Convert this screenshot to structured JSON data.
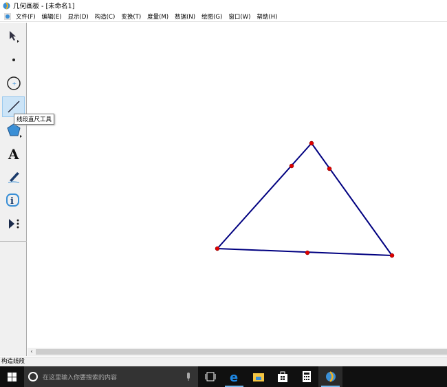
{
  "window": {
    "title": "几何画板 - [未命名1]"
  },
  "menu": [
    "文件(F)",
    "编辑(E)",
    "显示(D)",
    "构造(C)",
    "变换(T)",
    "度量(M)",
    "数据(N)",
    "绘图(G)",
    "窗口(W)",
    "帮助(H)"
  ],
  "toolbox": {
    "tooltip": "线段直尺工具",
    "tools": [
      "arrow",
      "point",
      "compass",
      "segment-straightedge",
      "polygon",
      "text",
      "marker",
      "information",
      "custom"
    ]
  },
  "status": "构造线段",
  "taskbar": {
    "search_placeholder": "在这里输入你要搜索的内容"
  },
  "colors": {
    "segment": "#000080",
    "point": "#e00000",
    "selected_tool": "#cce4f7"
  }
}
